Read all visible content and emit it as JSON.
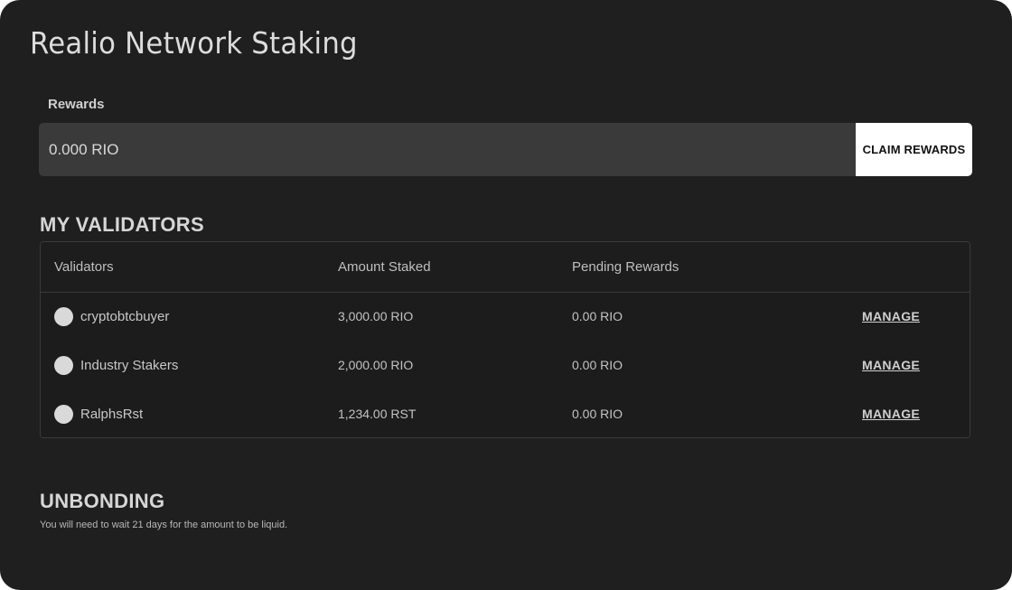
{
  "page": {
    "title": "Realio Network Staking"
  },
  "rewards": {
    "label": "Rewards",
    "value": "0.000 RIO",
    "claim_label": "CLAIM REWARDS"
  },
  "validators": {
    "heading": "MY VALIDATORS",
    "columns": [
      "Validators",
      "Amount Staked",
      "Pending Rewards"
    ],
    "rows": [
      {
        "name": "cryptobtcbuyer",
        "staked": "3,000.00 RIO",
        "pending": "0.00 RIO",
        "action": "MANAGE"
      },
      {
        "name": "Industry Stakers",
        "staked": "2,000.00 RIO",
        "pending": "0.00 RIO",
        "action": "MANAGE"
      },
      {
        "name": "RalphsRst",
        "staked": "1,234.00 RST",
        "pending": "0.00 RIO",
        "action": "MANAGE"
      }
    ]
  },
  "unbonding": {
    "heading": "UNBONDING",
    "note": "You will need to wait 21 days for the amount to be liquid."
  }
}
